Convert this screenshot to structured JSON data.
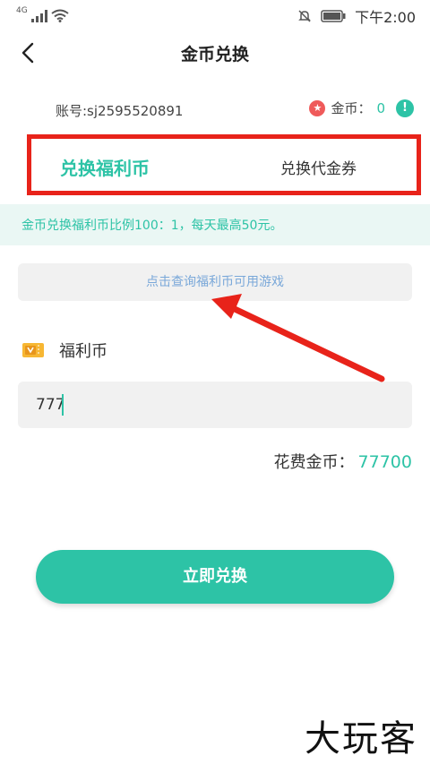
{
  "status_bar": {
    "network": "4G",
    "time": "下午2:00"
  },
  "nav": {
    "title": "金币兑换",
    "back_icon": "chevron-left-icon"
  },
  "account": {
    "label": "账号:sj2595520891",
    "coin_label": "金币：",
    "coin_value": "0",
    "info_icon": "!"
  },
  "tabs": [
    {
      "label": "兑换福利币",
      "active": true
    },
    {
      "label": "兑换代金券",
      "active": false
    }
  ],
  "ratio_notice": "金币兑换福利币比例100：1，每天最高50元。",
  "query_button": "点击查询福利币可用游戏",
  "welfare": {
    "label": "福利币",
    "icon": "ticket-icon"
  },
  "amount_input": {
    "value": "777"
  },
  "cost": {
    "label": "花费金币：",
    "value": "77700"
  },
  "submit_button": "立即兑换",
  "watermark": "大玩客",
  "colors": {
    "accent": "#2dc3a6",
    "highlight_border": "#e8231a",
    "link_text": "#7aa8d9",
    "star": "#ef5a5a"
  }
}
